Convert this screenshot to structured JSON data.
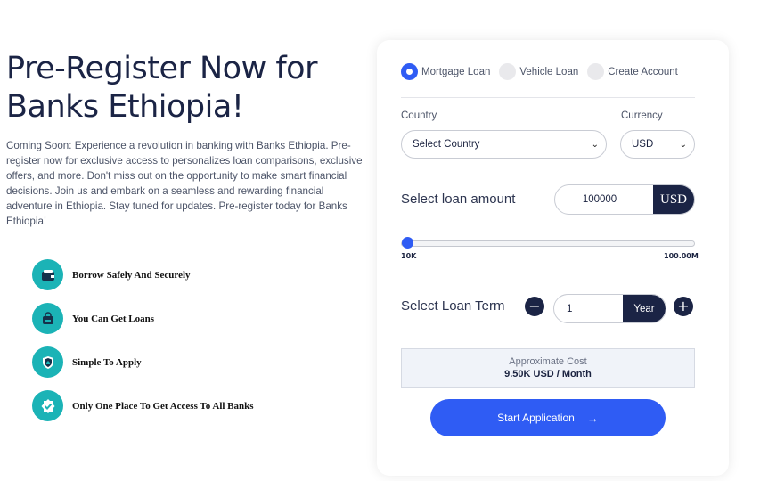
{
  "hero": {
    "title": "Pre-Register Now for Banks Ethiopia!",
    "description": "Coming Soon: Experience a revolution in banking with Banks Ethiopia. Pre-register now for exclusive access to personalizes loan comparisons, exclusive offers, and more. Don't miss out on the opportunity to make smart financial decisions. Join us and embark on a seamless and rewarding financial adventure in Ethiopia. Stay tuned for updates. Pre-register today for Banks Ethiopia!"
  },
  "features": [
    {
      "label": "Borrow Safely And Securely",
      "icon": "wallet-icon"
    },
    {
      "label": "You Can Get Loans",
      "icon": "bag-icon"
    },
    {
      "label": "Simple To Apply",
      "icon": "shield-icon"
    },
    {
      "label": "Only One Place To Get Access To All Banks",
      "icon": "badge-check-icon"
    }
  ],
  "tabs": [
    {
      "label": "Mortgage Loan",
      "selected": true
    },
    {
      "label": "Vehicle Loan",
      "selected": false
    },
    {
      "label": "Create Account",
      "selected": false
    }
  ],
  "form": {
    "country_label": "Country",
    "country_value": "Select Country",
    "currency_label": "Currency",
    "currency_value": "USD",
    "amount_label": "Select loan amount",
    "amount_value": "100000",
    "amount_currency": "USD",
    "slider_min": "10K",
    "slider_max": "100.00M",
    "slider_fraction": 0.001,
    "term_label": "Select Loan Term",
    "term_minus": "−",
    "term_plus": "+",
    "term_value": "1",
    "term_unit": "Year",
    "cost_label": "Approximate Cost",
    "cost_value": "9.50K USD / Month",
    "start_label": "Start Application",
    "start_arrow": "→"
  },
  "colors": {
    "accent": "#2f5cf4",
    "navy": "#1b2445",
    "teal": "#1bb3b6"
  }
}
